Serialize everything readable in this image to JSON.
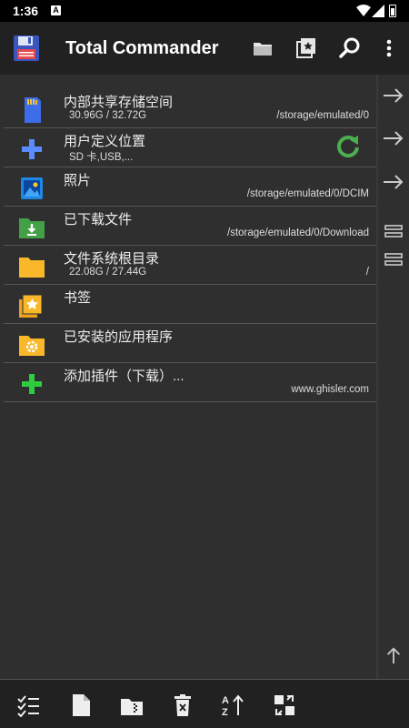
{
  "status_bar": {
    "time": "1:36",
    "notification_icon": "A"
  },
  "app_bar": {
    "title": "Total Commander",
    "icons": [
      "floppy-logo-icon",
      "folder-icon",
      "bookmarks-icon",
      "search-icon",
      "more-vert-icon"
    ]
  },
  "items": [
    {
      "name": "内部共享存储空间",
      "sub": "30.96G / 32.72G",
      "path": "/storage/emulated/0",
      "icon": "sd-card-icon"
    },
    {
      "name": "用户定义位置",
      "sub": "SD 卡,USB,...",
      "path": "",
      "icon": "plus-blue-icon"
    },
    {
      "name": "照片",
      "sub": "",
      "path": "/storage/emulated/0/DCIM",
      "icon": "photo-icon"
    },
    {
      "name": "已下载文件",
      "sub": "",
      "path": "/storage/emulated/0/Download",
      "icon": "download-folder-icon"
    },
    {
      "name": "文件系统根目录",
      "sub": "22.08G / 27.44G",
      "path": "/",
      "icon": "folder-icon"
    },
    {
      "name": "书签",
      "sub": "",
      "path": "",
      "icon": "bookmark-folder-icon"
    },
    {
      "name": "已安装的应用程序",
      "sub": "",
      "path": "",
      "icon": "apps-folder-icon"
    },
    {
      "name": "添加插件（下载）...",
      "sub": "",
      "path": "www.ghisler.com",
      "icon": "plus-green-icon"
    }
  ],
  "bottom_bar": {
    "icons": [
      "select-icon",
      "new-file-icon",
      "zip-icon",
      "delete-icon",
      "sort-icon",
      "swap-panels-icon"
    ]
  },
  "colors": {
    "background": "#2f2f2f",
    "bar": "#212121",
    "accent_green": "#4caf50",
    "accent_blue": "#4a7fff",
    "folder_yellow": "#f9b82a"
  }
}
